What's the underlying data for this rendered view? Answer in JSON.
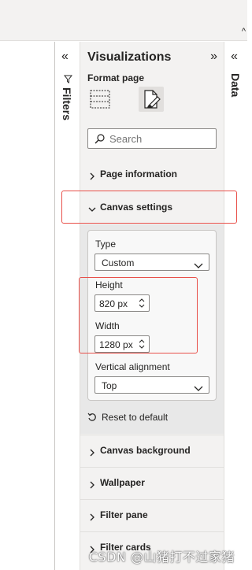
{
  "filters_pane": {
    "label": "Filters",
    "collapse_glyph": "«"
  },
  "viz_pane": {
    "title": "Visualizations",
    "collapse_glyph": "»",
    "format_label": "Format page",
    "search": {
      "placeholder": "Search",
      "value": ""
    },
    "sections": {
      "page_information": "Page information",
      "canvas_settings": "Canvas settings",
      "canvas_background": "Canvas background",
      "wallpaper": "Wallpaper",
      "filter_pane": "Filter pane",
      "filter_cards": "Filter cards"
    },
    "canvas_settings": {
      "type_label": "Type",
      "type_value": "Custom",
      "height_label": "Height",
      "height_value": "820 px",
      "width_label": "Width",
      "width_value": "1280 px",
      "valign_label": "Vertical alignment",
      "valign_value": "Top",
      "reset_label": "Reset to default"
    }
  },
  "data_pane": {
    "label": "Data",
    "collapse_glyph": "«"
  },
  "watermark": "CSDN @山猪打不过家猪",
  "colors": {
    "highlight": "#e8504a",
    "pane_bg": "#f3f2f1"
  }
}
